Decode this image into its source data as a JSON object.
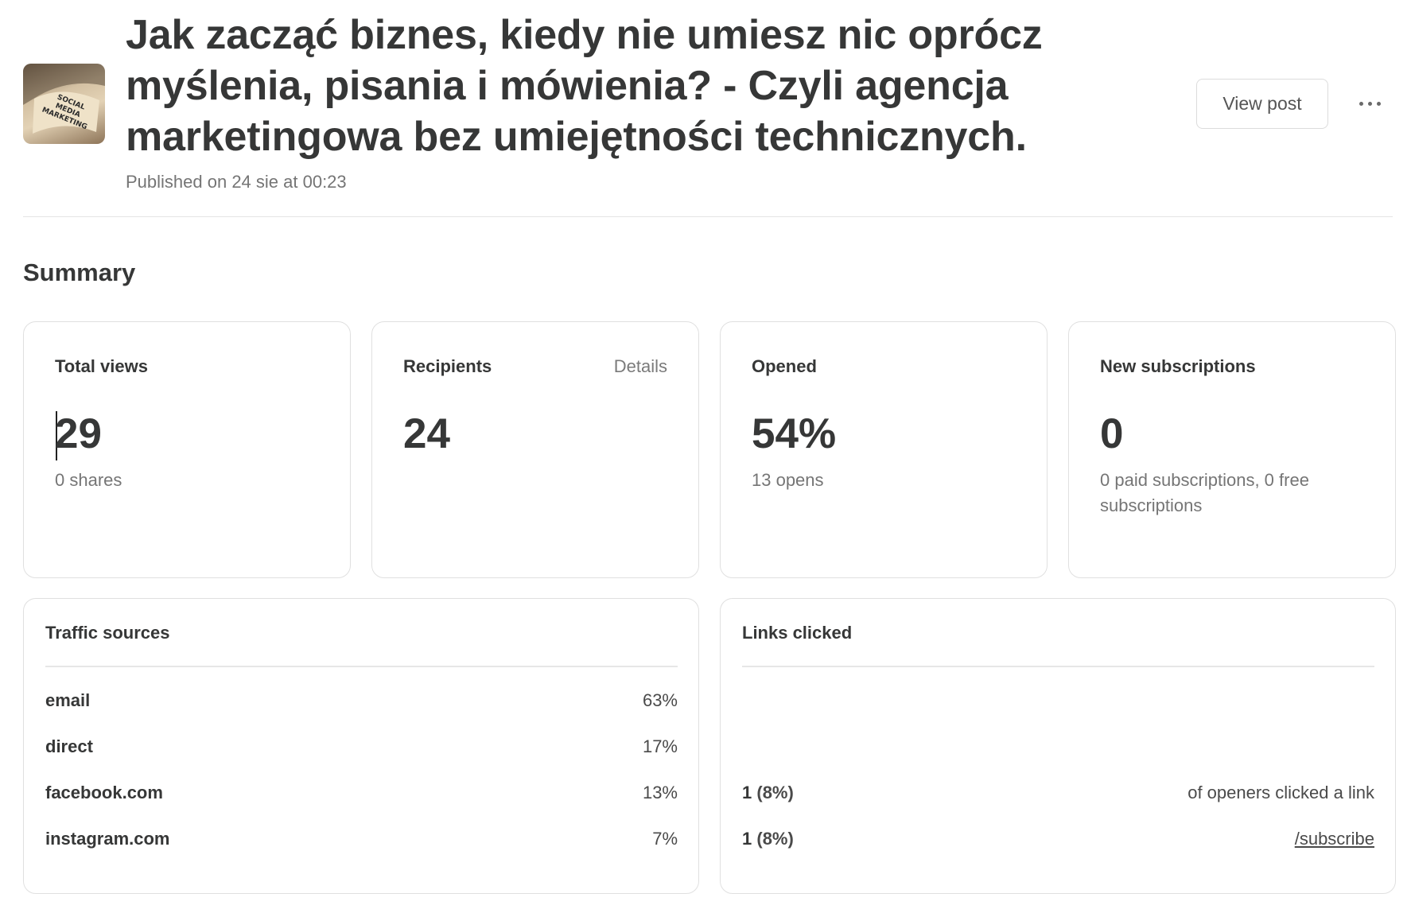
{
  "post": {
    "title": "Jak zacząć biznes, kiedy nie umiesz nic oprócz myślenia, pisania i mówienia? - Czyli agencja marketingowa bez umiejętności technicznych.",
    "published": "Published on 24 sie at 00:23",
    "thumbnail_text": [
      "SOCIAL",
      "MEDIA",
      "MARKETING"
    ],
    "view_post_label": "View post",
    "more_icon": "more-horizontal-icon"
  },
  "summary": {
    "heading": "Summary",
    "total_views": {
      "label": "Total views",
      "value": "29",
      "sub": "0 shares"
    },
    "recipients": {
      "label": "Recipients",
      "details_label": "Details",
      "value": "24"
    },
    "opened": {
      "label": "Opened",
      "value": "54%",
      "sub": "13 opens"
    },
    "new_subscriptions": {
      "label": "New subscriptions",
      "value": "0",
      "sub": "0 paid subscriptions, 0 free subscriptions"
    }
  },
  "traffic_sources": {
    "title": "Traffic sources",
    "rows": [
      {
        "source": "email",
        "percent": "63%"
      },
      {
        "source": "direct",
        "percent": "17%"
      },
      {
        "source": "facebook.com",
        "percent": "13%"
      },
      {
        "source": "instagram.com",
        "percent": "7%"
      }
    ]
  },
  "links_clicked": {
    "title": "Links clicked",
    "rows": [
      {
        "count": "1",
        "percent": "(8%)",
        "label": "of openers clicked a link"
      },
      {
        "count": "1",
        "percent": "(8%)",
        "label": "/subscribe"
      }
    ]
  },
  "colors": {
    "text": "#363737",
    "muted": "#757575",
    "border": "#e0e0e0"
  }
}
